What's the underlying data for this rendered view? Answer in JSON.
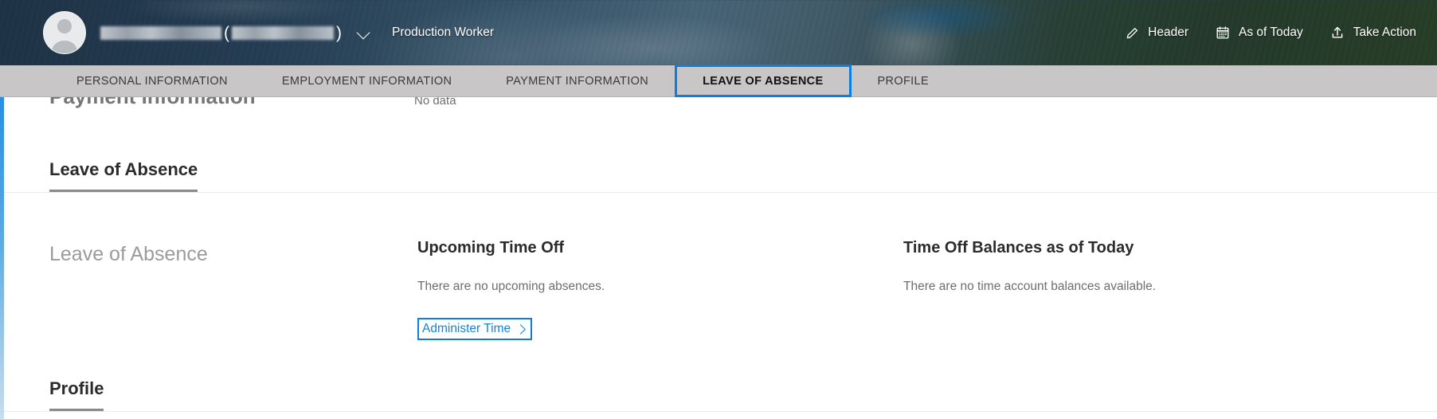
{
  "header": {
    "avatar_icon": "person-avatar-icon",
    "name_redacted": true,
    "open_paren": "(",
    "close_paren": ")",
    "chevron_icon": "chevron-down-icon",
    "job_title": "Production Worker",
    "actions": [
      {
        "label": "Header",
        "icon": "pencil-edit-icon"
      },
      {
        "label": "As of Today",
        "icon": "calendar-icon"
      },
      {
        "label": "Take Action",
        "icon": "upload-share-icon"
      }
    ]
  },
  "tabs": [
    {
      "label": "PERSONAL INFORMATION",
      "active": false
    },
    {
      "label": "EMPLOYMENT INFORMATION",
      "active": false
    },
    {
      "label": "PAYMENT INFORMATION",
      "active": false
    },
    {
      "label": "LEAVE OF ABSENCE",
      "active": true
    },
    {
      "label": "PROFILE",
      "active": false
    }
  ],
  "ghost_section": {
    "title": "Payment Information",
    "no_data": "No data"
  },
  "leave_of_absence": {
    "section_title": "Leave of Absence",
    "row_label": "Leave of Absence",
    "upcoming": {
      "heading": "Upcoming Time Off",
      "empty_text": "There are no upcoming absences.",
      "button_label": "Administer Time",
      "button_chevron": "chevron-right-icon"
    },
    "balances": {
      "heading": "Time Off Balances as of Today",
      "empty_text": "There are no time account balances available."
    }
  },
  "profile_section": {
    "section_title": "Profile"
  },
  "colors": {
    "accent_blue": "#0b7fe0",
    "link_blue": "#1384d8",
    "tabbar_gray": "#c8c6c6",
    "heading_dark": "#2b2b2b",
    "muted_gray": "#6e6e6e",
    "placeholder_gray": "#9b9b9b"
  }
}
